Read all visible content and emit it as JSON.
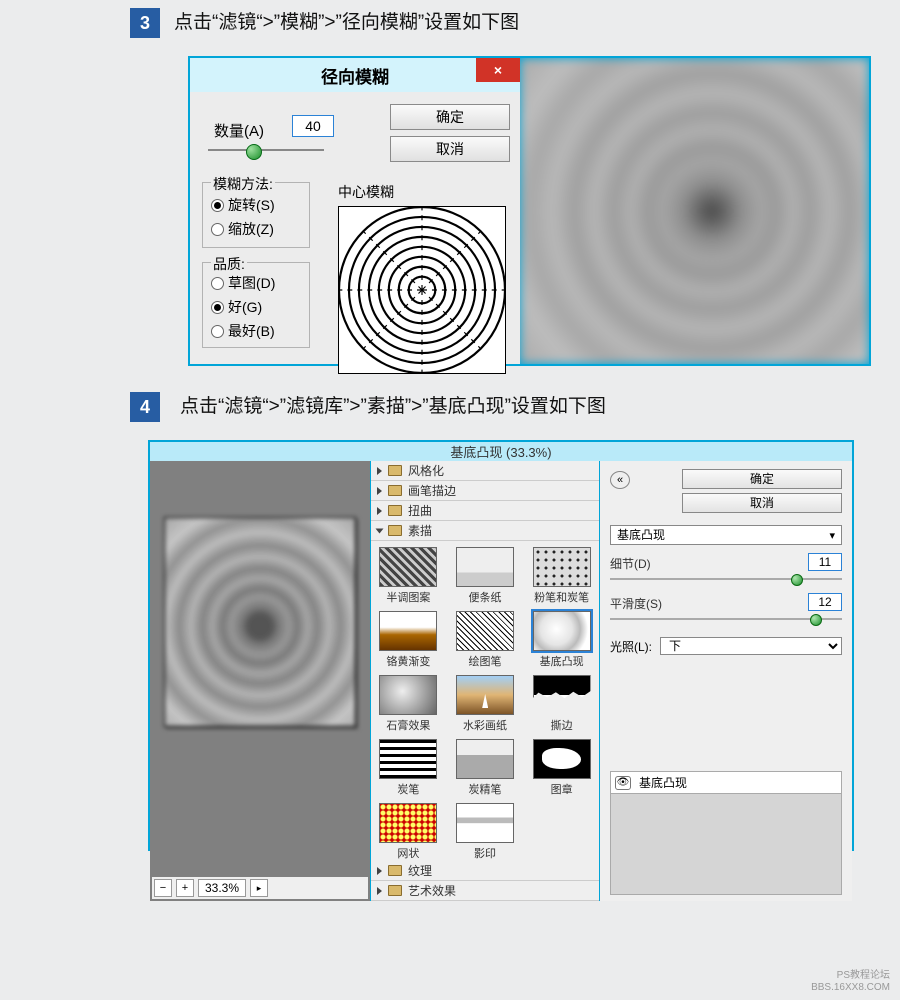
{
  "step3": {
    "num": "3",
    "text": "点击“滤镜“>”模糊”>”径向模糊”设置如下图",
    "dialog": {
      "title": "径向模糊",
      "close": "×",
      "amount_label": "数量(A)",
      "amount_value": "40",
      "ok": "确定",
      "cancel": "取消",
      "method_title": "模糊方法:",
      "method_spin": "旋转(S)",
      "method_zoom": "缩放(Z)",
      "quality_title": "品质:",
      "quality_draft": "草图(D)",
      "quality_good": "好(G)",
      "quality_best": "最好(B)",
      "center_label": "中心模糊"
    }
  },
  "step4": {
    "num": "4",
    "text": "点击“滤镜“>”滤镜库”>”素描”>”基底凸现”设置如下图",
    "dialog": {
      "title": "基底凸现 (33.3%)",
      "status_zoom": "33.3%",
      "folders": {
        "f1": "风格化",
        "f2": "画笔描边",
        "f3": "扭曲",
        "f4": "素描",
        "f5": "纹理",
        "f6": "艺术效果"
      },
      "thumbs": {
        "t1": "半调图案",
        "t2": "便条纸",
        "t3": "粉笔和炭笔",
        "t4": "铬黄渐变",
        "t5": "绘图笔",
        "t6": "基底凸现",
        "t7": "石膏效果",
        "t8": "水彩画纸",
        "t9": "撕边",
        "t10": "炭笔",
        "t11": "炭精笔",
        "t12": "图章",
        "t13": "网状",
        "t14": "影印"
      },
      "ok": "确定",
      "cancel": "取消",
      "filter_name": "基底凸现",
      "detail_label": "细节(D)",
      "detail_value": "11",
      "smooth_label": "平滑度(S)",
      "smooth_value": "12",
      "light_label": "光照(L):",
      "light_value": "下",
      "layer_entry": "基底凸现"
    }
  },
  "watermark": {
    "l1": "PS教程论坛",
    "l2": "BBS.16XX8.COM"
  }
}
